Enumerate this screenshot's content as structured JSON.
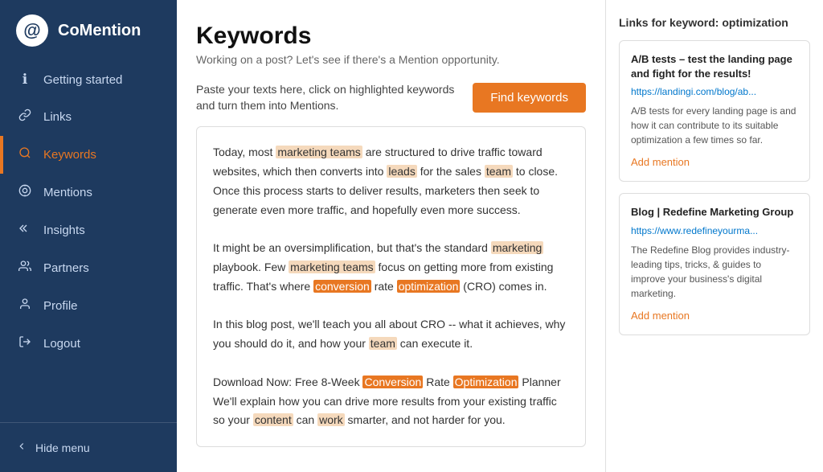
{
  "sidebar": {
    "logo_symbol": "@",
    "logo_text": "CoMention",
    "nav_items": [
      {
        "id": "getting-started",
        "label": "Getting started",
        "icon": "ℹ",
        "active": false
      },
      {
        "id": "links",
        "label": "Links",
        "icon": "🔗",
        "active": false
      },
      {
        "id": "keywords",
        "label": "Keywords",
        "icon": "🔍",
        "active": true
      },
      {
        "id": "mentions",
        "label": "Mentions",
        "icon": "💬",
        "active": false
      },
      {
        "id": "insights",
        "label": "Insights",
        "icon": "≪",
        "active": false
      },
      {
        "id": "partners",
        "label": "Partners",
        "icon": "👥",
        "active": false
      },
      {
        "id": "profile",
        "label": "Profile",
        "icon": "👤",
        "active": false
      },
      {
        "id": "logout",
        "label": "Logout",
        "icon": "⎋",
        "active": false
      }
    ],
    "hide_menu_label": "Hide menu"
  },
  "main": {
    "page_title": "Keywords",
    "page_subtitle": "Working on a post? Let's see if there's a Mention opportunity.",
    "toolbar_text": "Paste your texts here, click on highlighted keywords and turn them into Mentions.",
    "find_keywords_btn": "Find keywords",
    "article_paragraphs": [
      "Today, most marketing teams are structured to drive traffic toward websites, which then converts into leads for the sales team to close. Once this process starts to deliver results, marketers then seek to generate even more traffic, and hopefully even more success.",
      "It might be an oversimplification, but that's the standard marketing playbook. Few marketing teams focus on getting more from existing traffic. That's where conversion rate optimization (CRO) comes in.",
      "In this blog post, we'll teach you all about CRO -- what it achieves, why you should do it, and how your team can execute it.",
      "Download Now: Free 8-Week Conversion Rate Optimization Planner",
      "We'll explain how you can drive more results from your existing traffic so your content can work smarter, and not harder for you."
    ]
  },
  "right_panel": {
    "header_prefix": "Links for keyword: ",
    "keyword": "optimization",
    "cards": [
      {
        "title": "A/B tests – test the landing page and fight for the results!",
        "url": "https://landingi.com/blog/ab...",
        "description": "A/B tests for every landing page is and how it can contribute to its suitable optimization a few times so far.",
        "add_mention_label": "Add mention"
      },
      {
        "title": "Blog | Redefine Marketing Group",
        "url": "https://www.redefineyourma...",
        "description": "The Redefine Blog provides industry-leading tips, tricks, & guides to improve your business's digital marketing.",
        "add_mention_label": "Add mention"
      }
    ]
  }
}
